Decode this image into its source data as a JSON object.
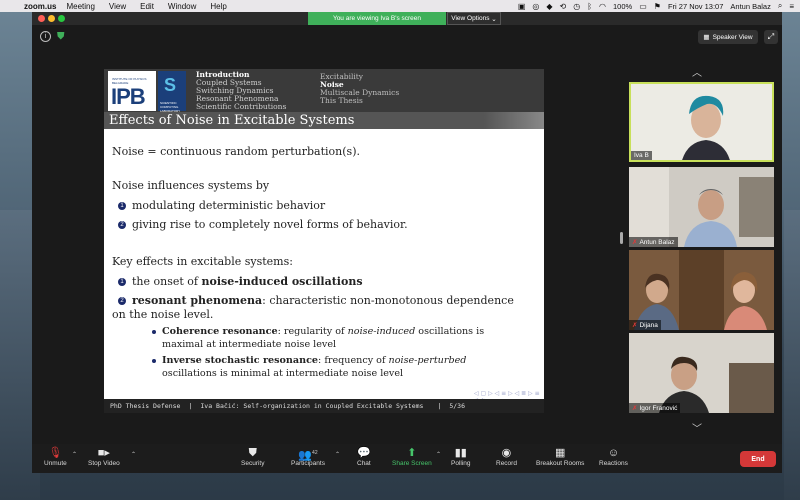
{
  "menubar": {
    "app": "zoom.us",
    "items": [
      "Meeting",
      "View",
      "Edit",
      "Window",
      "Help"
    ],
    "battery": "100%",
    "datetime": "Fri 27 Nov  13:07",
    "user": "Antun Balaz"
  },
  "window": {
    "banner": "You are viewing Iva B's screen",
    "view_options": "View Options",
    "speaker_view": "Speaker View"
  },
  "slide": {
    "nav_left": [
      "Introduction",
      "Coupled Systems",
      "Switching Dynamics",
      "Resonant Phenomena",
      "Scientific Contributions"
    ],
    "nav_right": [
      "Excitability",
      "Noise",
      "Multiscale Dynamics",
      "This Thesis"
    ],
    "logo_text_top": "INSTITUTE OF PHYSICS BELGRADE",
    "logo_text_big": "IPB",
    "logo2_text": "SCIENTIFIC COMPUTING LABORATORY",
    "title": "Effects of Noise in Excitable Systems",
    "line1": "Noise = continuous random perturbation(s).",
    "line2": "Noise influences systems by",
    "bullet1": "modulating deterministic behavior",
    "bullet2": "giving rise to completely novel forms of behavior.",
    "line3": "Key effects in excitable systems:",
    "k1_pre": "the onset of ",
    "k1_bold": "noise-induced oscillations",
    "k2_bold": "resonant phenomena",
    "k2_rest": ": characteristic non-monotonous dependence",
    "k2_cont": "on the noise level.",
    "s1_bold": "Coherence resonance",
    "s1_a": ": regularity of ",
    "s1_it": "noise-induced",
    "s1_b": " oscillations is",
    "s1_c": "maximal at intermediate noise level",
    "s2_bold": "Inverse stochastic resonance",
    "s2_a": ": frequency of ",
    "s2_it": "noise-perturbed",
    "s2_c": "oscillations is minimal at intermediate noise level",
    "footer_left": "PhD Thesis Defense",
    "footer_mid": "Iva Bačić: Self-organization in Coupled Excitable Systems",
    "footer_page": "5/36"
  },
  "participants": [
    {
      "name": "Iva B",
      "muted": false,
      "active": true
    },
    {
      "name": "Antun Balaz",
      "muted": true,
      "active": false
    },
    {
      "name": "Dijana",
      "muted": true,
      "active": false
    },
    {
      "name": "Igor Franović",
      "muted": true,
      "active": false
    }
  ],
  "toolbar": {
    "unmute": "Unmute",
    "stop_video": "Stop Video",
    "security": "Security",
    "participants": "Participants",
    "participants_count": "42",
    "chat": "Chat",
    "share_screen": "Share Screen",
    "polling": "Polling",
    "record": "Record",
    "breakout": "Breakout Rooms",
    "reactions": "Reactions",
    "end": "End"
  },
  "colors": {
    "accent_green": "#3fb05a",
    "end_red": "#d43838",
    "active_border": "#c8e05a"
  }
}
